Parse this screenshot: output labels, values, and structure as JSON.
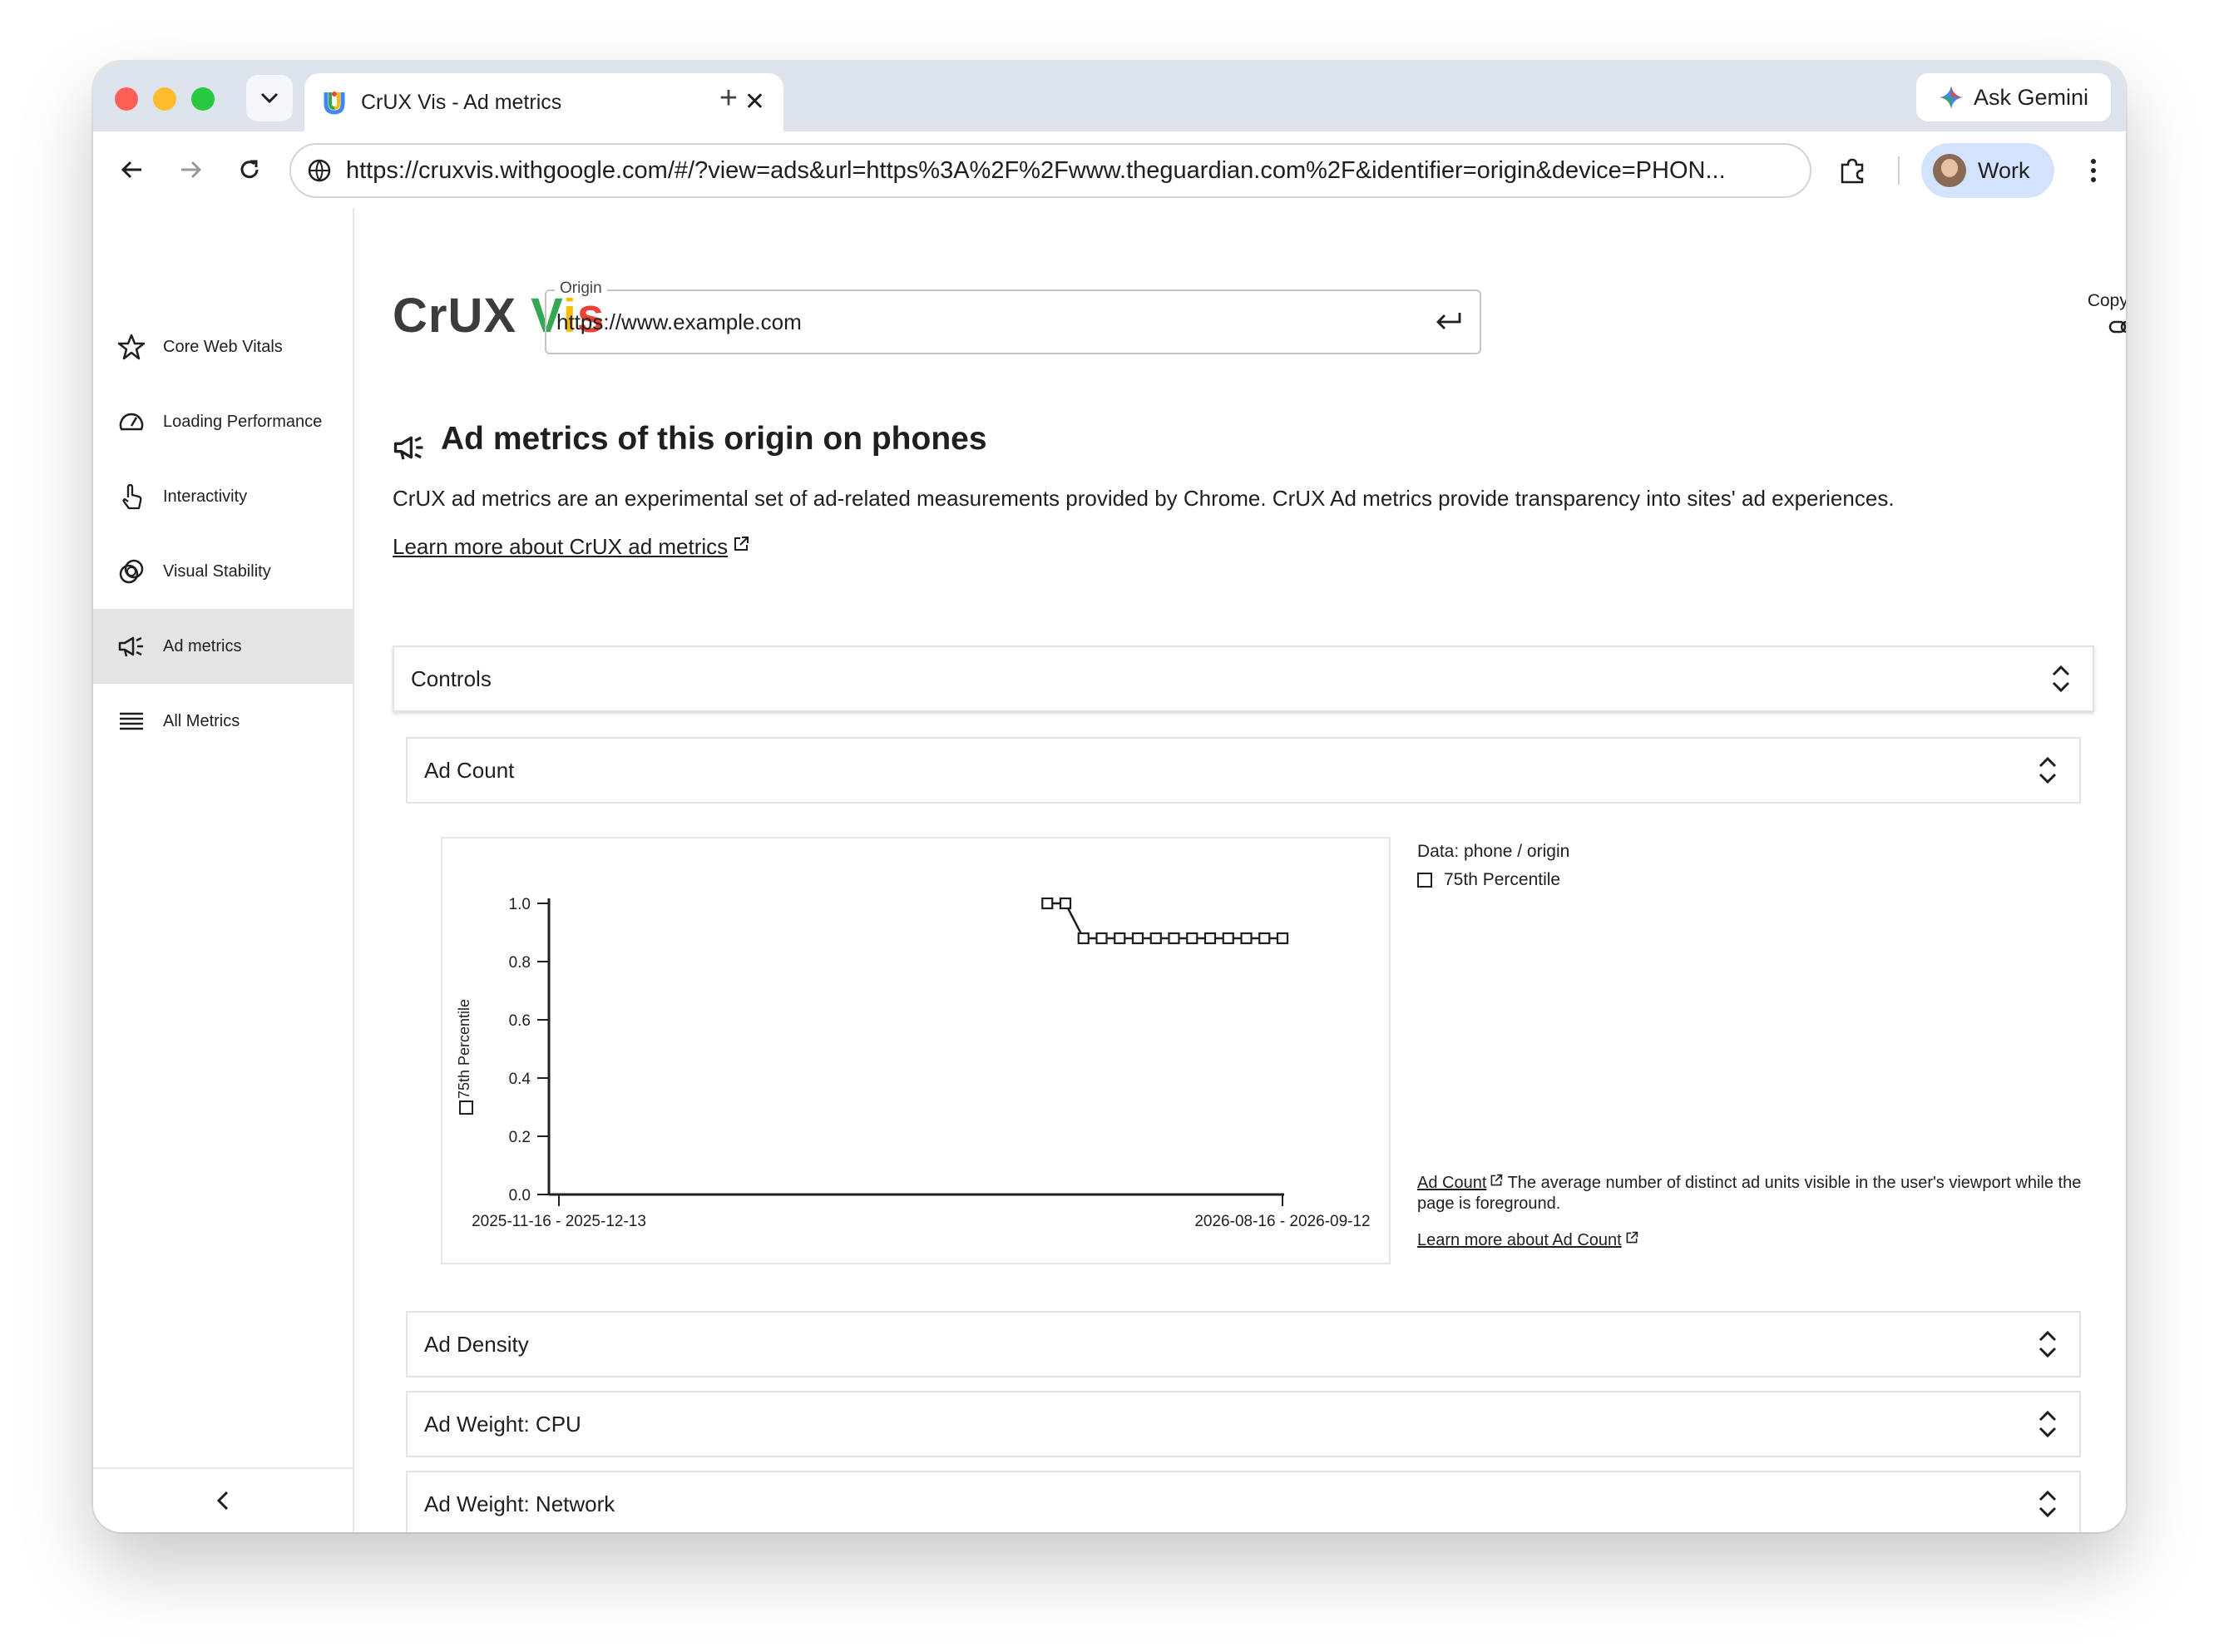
{
  "browser": {
    "tab_title": "CrUX Vis - Ad metrics",
    "new_tab_symbol": "+",
    "close_symbol": "✕",
    "ask_gemini_label": "Ask Gemini",
    "url": "https://cruxvis.withgoogle.com/#/?view=ads&url=https%3A%2F%2Fwww.theguardian.com%2F&identifier=origin&device=PHON...",
    "profile_label": "Work"
  },
  "sidebar": {
    "items": [
      {
        "label": "Core Web Vitals",
        "icon": "star-icon"
      },
      {
        "label": "Loading Performance",
        "icon": "speedometer-icon"
      },
      {
        "label": "Interactivity",
        "icon": "touch-icon"
      },
      {
        "label": "Visual Stability",
        "icon": "rings-icon"
      },
      {
        "label": "Ad metrics",
        "icon": "megaphone-icon",
        "active": true
      },
      {
        "label": "All Metrics",
        "icon": "list-icon"
      }
    ]
  },
  "header": {
    "logo_crux": "CrUX ",
    "logo_v": "V",
    "logo_i": "i",
    "logo_s": "s",
    "origin_label": "Origin",
    "origin_value": "https://www.example.com",
    "copy_link_label": "Copy link"
  },
  "page": {
    "title": "Ad metrics of this origin on phones",
    "description": "CrUX ad metrics are an experimental set of ad-related measurements provided by Chrome. CrUX Ad metrics provide transparency into sites' ad experiences.",
    "learn_more": "Learn more about CrUX ad metrics"
  },
  "panels": {
    "controls": "Controls",
    "ad_count": "Ad Count",
    "ad_density": "Ad Density",
    "ad_weight_cpu": "Ad Weight: CPU",
    "ad_weight_network": "Ad Weight: Network"
  },
  "legend": {
    "data_label": "Data: phone / origin",
    "series_label": "75th Percentile"
  },
  "metric_info": {
    "name": "Ad Count",
    "description": "The average number of distinct ad units visible in the user's viewport while the page is foreground.",
    "learn_more": "Learn more about Ad Count"
  },
  "colors": {
    "logo_v": "#34a853",
    "logo_i": "#fbbc04",
    "logo_s": "#ea4335",
    "active_sidebar": "#e4e4e4",
    "profile_chip": "#d3e3fd"
  },
  "chart_data": {
    "type": "line",
    "ylabel": "75th Percentile",
    "ylim": [
      0,
      1.0
    ],
    "yticks": [
      "0.0",
      "0.2",
      "0.4",
      "0.6",
      "0.8",
      "1.0"
    ],
    "x_tick_labels": [
      "2025-11-16 - 2025-12-13",
      "2026-08-16 - 2026-09-12"
    ],
    "series": [
      {
        "name": "75th Percentile",
        "x_index": [
          27,
          28,
          29,
          30,
          31,
          32,
          33,
          34,
          35,
          36,
          37,
          38,
          39,
          40
        ],
        "values": [
          1.0,
          1.0,
          0.88,
          0.88,
          0.88,
          0.88,
          0.88,
          0.88,
          0.88,
          0.88,
          0.88,
          0.88,
          0.88,
          0.88
        ]
      }
    ],
    "x_range": [
      0,
      40
    ]
  }
}
